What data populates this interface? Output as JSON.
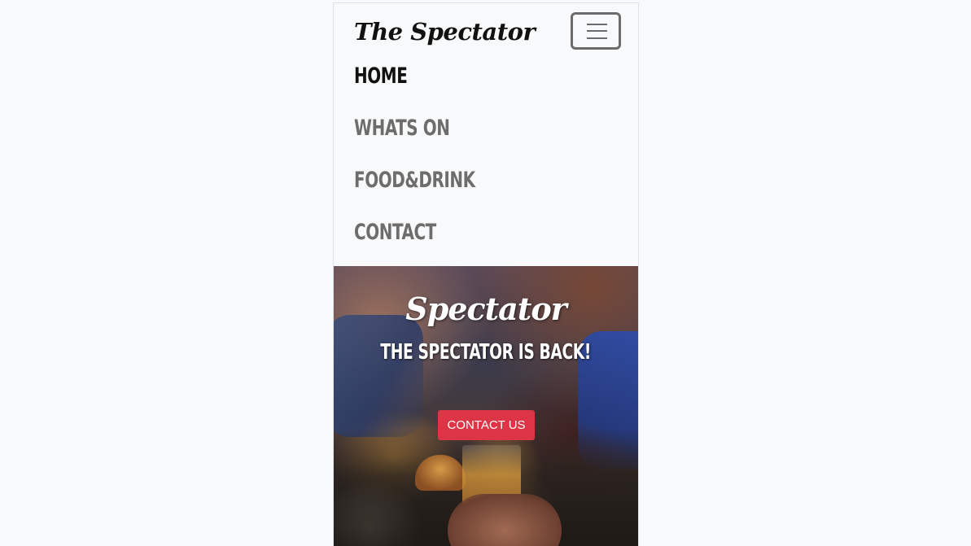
{
  "navbar": {
    "brand": "The Spectator",
    "toggler_icon": "hamburger-menu-icon",
    "links": [
      {
        "label": "HOME",
        "active": true
      },
      {
        "label": "WHATS ON",
        "active": false
      },
      {
        "label": "FOOD&DRINK",
        "active": false
      },
      {
        "label": "CONTACT",
        "active": false
      }
    ]
  },
  "hero": {
    "title": "Spectator",
    "tagline_prefix": "THE SPECTATOR IS ",
    "tagline_emphasis": "BACK!",
    "button_label": "CONTACT US",
    "button_color": "#dc3545"
  }
}
